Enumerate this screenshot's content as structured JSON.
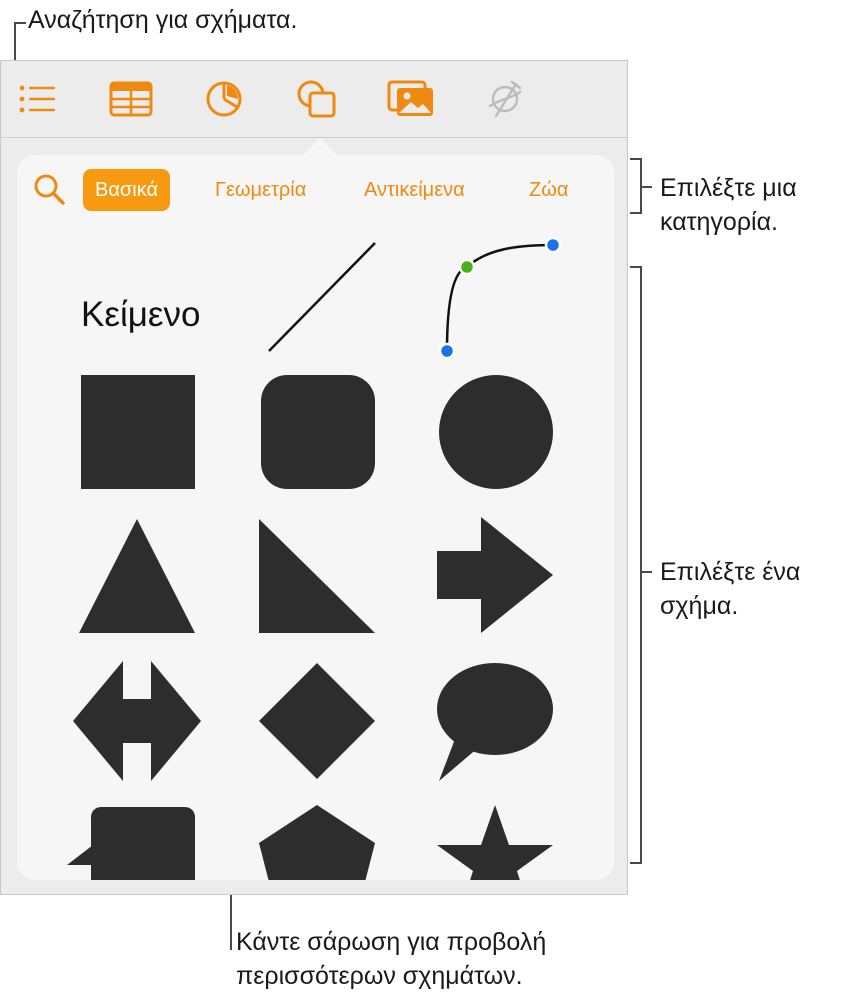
{
  "callouts": {
    "search": "Αναζήτηση για σχήματα.",
    "category": [
      "Επιλέξτε μια",
      "κατηγορία."
    ],
    "shape": [
      "Επιλέξτε ένα",
      "σχήμα."
    ],
    "swipe": [
      "Κάντε σάρωση για προβολή",
      "περισσότερων σχημάτων."
    ]
  },
  "toolbar": {
    "buttons": [
      {
        "name": "list-icon",
        "state": "normal"
      },
      {
        "name": "table-icon",
        "state": "normal"
      },
      {
        "name": "chart-icon",
        "state": "normal"
      },
      {
        "name": "shapes-icon",
        "state": "selected"
      },
      {
        "name": "media-icon",
        "state": "normal"
      },
      {
        "name": "drawing-icon",
        "state": "disabled"
      }
    ]
  },
  "categories": {
    "items": [
      "Βασικά",
      "Γεωμετρία",
      "Αντικείμενα",
      "Ζώα"
    ],
    "selected": "Βασικά"
  },
  "shapes": {
    "text_label": "Κείμενο",
    "items": [
      "text",
      "line",
      "curve",
      "square",
      "rounded-square",
      "circle",
      "triangle",
      "right-triangle",
      "arrow",
      "double-arrow",
      "diamond",
      "speech-bubble",
      "callout",
      "pentagon",
      "star"
    ]
  },
  "colors": {
    "accent": "#f0890f",
    "selected_category_bg": "#f79a12",
    "shape_fill": "#2d2d2d",
    "curve_end_point": "#1a73e8",
    "curve_control_point": "#4caf1c",
    "disabled_icon": "#bdbdbd"
  }
}
